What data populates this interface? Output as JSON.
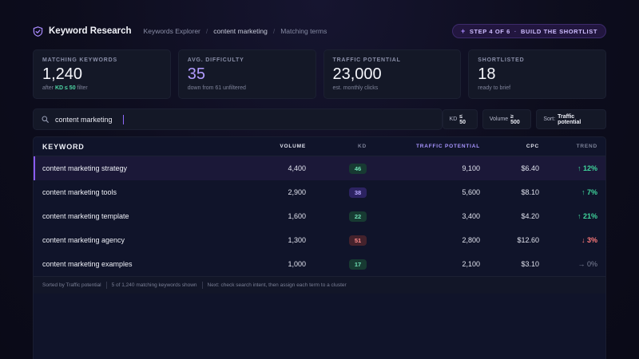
{
  "app": {
    "name": "Keyword Research"
  },
  "breadcrumb": [
    "Keywords Explorer",
    "content marketing",
    "Matching terms"
  ],
  "step": {
    "label": "STEP 4 OF 6",
    "task": "BUILD THE SHORTLIST"
  },
  "stats": [
    {
      "label": "MATCHING KEYWORDS",
      "value": "1,240",
      "sub_before": "after ",
      "sub_highlight": "KD ≤ 50",
      "sub_after": " filter"
    },
    {
      "label": "AVG. DIFFICULTY",
      "value": "35",
      "sub": "down from 61 unfiltered"
    },
    {
      "label": "TRAFFIC POTENTIAL",
      "value": "23,000",
      "sub": "est. monthly clicks"
    },
    {
      "label": "SHORTLISTED",
      "value": "18",
      "sub": "ready to brief"
    }
  ],
  "search": {
    "value": "content marketing"
  },
  "filters": [
    {
      "key": "KD",
      "value": "≤ 50"
    },
    {
      "key": "Volume",
      "value": "≥ 500"
    },
    {
      "key": "Sort:",
      "value": "Traffic potential"
    }
  ],
  "table": {
    "columns": [
      "KEYWORD",
      "VOLUME",
      "KD",
      "TRAFFIC POTENTIAL",
      "CPC",
      "TREND"
    ],
    "rows": [
      {
        "keyword": "content marketing strategy",
        "volume": "4,400",
        "kd": "46",
        "traffic": "9,100",
        "cpc": "$6.40",
        "trend": "↑ 12%"
      },
      {
        "keyword": "content marketing tools",
        "volume": "2,900",
        "kd": "38",
        "traffic": "5,600",
        "cpc": "$8.10",
        "trend": "↑ 7%"
      },
      {
        "keyword": "content marketing template",
        "volume": "1,600",
        "kd": "22",
        "traffic": "3,400",
        "cpc": "$4.20",
        "trend": "↑ 21%"
      },
      {
        "keyword": "content marketing agency",
        "volume": "1,300",
        "kd": "51",
        "traffic": "2,800",
        "cpc": "$12.60",
        "trend": "↓ 3%"
      },
      {
        "keyword": "content marketing examples",
        "volume": "1,000",
        "kd": "17",
        "traffic": "2,100",
        "cpc": "$3.10",
        "trend": "→ 0%"
      }
    ],
    "footer": [
      "Sorted by Traffic potential",
      "5 of 1,240 matching keywords shown",
      "Next: check search intent, then assign each term to a cluster"
    ]
  },
  "colors": {
    "accent": "#8b5cf6",
    "trend_up": "#3fd69c",
    "trend_down": "#ff7a7a",
    "kd_easy": "#6fe0b5",
    "kd_mid": "#b7a8ff",
    "kd_hard": "#ff8a8a"
  },
  "icons": {
    "brand": "check-shield-icon",
    "search": "search-icon",
    "step": "plus-icon"
  }
}
